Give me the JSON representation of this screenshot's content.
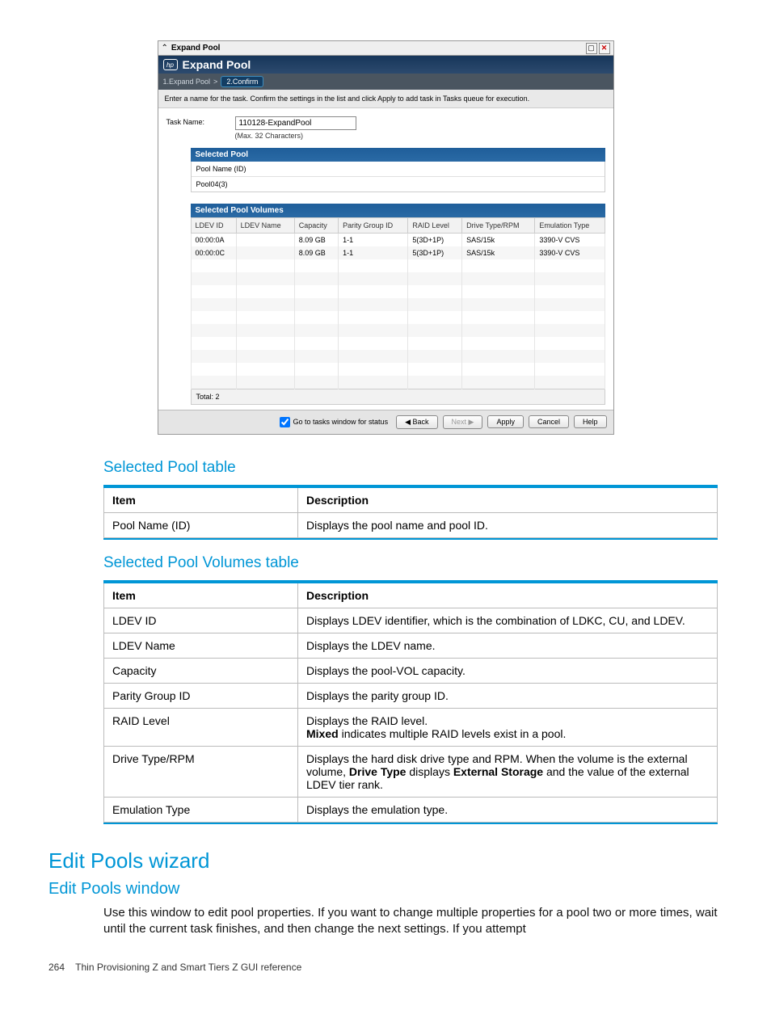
{
  "dialog": {
    "titlebar": {
      "title": "Expand Pool"
    },
    "header": {
      "logo": "hp",
      "title": "Expand Pool"
    },
    "steps": {
      "step1": "1.Expand Pool",
      "sep": ">",
      "step2": "2.Confirm"
    },
    "instruction": "Enter a name for the task. Confirm the settings in the list and click Apply to add task in Tasks queue for execution.",
    "task": {
      "label": "Task Name:",
      "value": "110128-ExpandPool",
      "hint": "(Max. 32 Characters)"
    },
    "selected_pool": {
      "title": "Selected Pool",
      "row1": "Pool Name (ID)",
      "row2": "Pool04(3)"
    },
    "selected_vol": {
      "title": "Selected Pool Volumes",
      "headers": [
        "LDEV ID",
        "LDEV Name",
        "Capacity",
        "Parity Group ID",
        "RAID Level",
        "Drive Type/RPM",
        "Emulation Type"
      ],
      "rows": [
        [
          "00:00:0A",
          "",
          "8.09 GB",
          "1-1",
          "5(3D+1P)",
          "SAS/15k",
          "3390-V CVS"
        ],
        [
          "00:00:0C",
          "",
          "8.09 GB",
          "1-1",
          "5(3D+1P)",
          "SAS/15k",
          "3390-V CVS"
        ]
      ],
      "total": "Total: 2"
    },
    "footer": {
      "check_label": "Go to tasks window for status",
      "back": "Back",
      "next": "Next",
      "apply": "Apply",
      "cancel": "Cancel",
      "help": "Help"
    }
  },
  "doc": {
    "h3a": "Selected Pool table",
    "table1": {
      "head": [
        "Item",
        "Description"
      ],
      "rows": [
        [
          "Pool Name (ID)",
          "Displays the pool name and pool ID."
        ]
      ]
    },
    "h3b": "Selected Pool Volumes table",
    "table2": {
      "head": [
        "Item",
        "Description"
      ],
      "rows": [
        {
          "c0": "LDEV ID",
          "c1": "Displays LDEV identifier, which is the combination of LDKC, CU, and LDEV."
        },
        {
          "c0": "LDEV Name",
          "c1": "Displays the LDEV name."
        },
        {
          "c0": "Capacity",
          "c1": "Displays the pool-VOL capacity."
        },
        {
          "c0": "Parity Group ID",
          "c1": "Displays the parity group ID."
        },
        {
          "c0": "RAID Level",
          "c1_pre": "Displays the RAID level.",
          "c1_bold": "Mixed",
          "c1_post": " indicates multiple RAID levels exist in a pool."
        },
        {
          "c0": "Drive Type/RPM",
          "c1_pre": "Displays the hard disk drive type and RPM. When the volume is the external volume, ",
          "c1_bold": "Drive Type",
          "c1_mid": " displays ",
          "c1_bold2": "External Storage",
          "c1_post": " and the value of the external LDEV tier rank."
        },
        {
          "c0": "Emulation Type",
          "c1": "Displays the emulation type."
        }
      ]
    },
    "h2": "Edit Pools wizard",
    "h3c": "Edit Pools window",
    "body": "Use this window to edit pool properties. If you want to change multiple properties for a pool two or more times, wait until the current task finishes, and then change the next settings. If you attempt",
    "footer": {
      "page": "264",
      "title": "Thin Provisioning Z and Smart Tiers Z GUI reference"
    }
  }
}
